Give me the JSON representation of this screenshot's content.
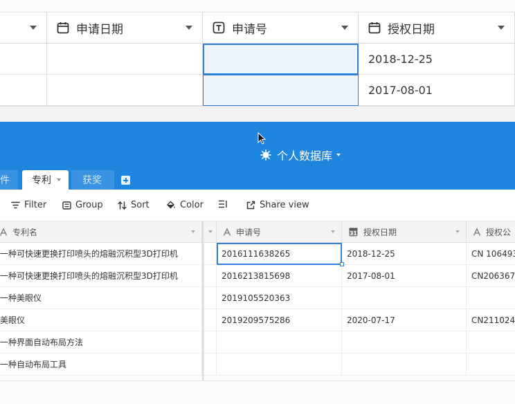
{
  "zoom_table": {
    "headers": [
      {
        "label": "",
        "icon": "none"
      },
      {
        "label": "申请日期",
        "icon": "calendar-icon"
      },
      {
        "label": "申请号",
        "icon": "text-field-icon"
      },
      {
        "label": "授权日期",
        "icon": "calendar-icon"
      }
    ],
    "rows": [
      [
        "",
        "",
        "",
        "2018-12-25"
      ],
      [
        "",
        "",
        "",
        "2017-08-01"
      ]
    ]
  },
  "app": {
    "db_title": "个人数据库",
    "tabs": [
      {
        "label": "件",
        "active": false
      },
      {
        "label": "专利",
        "active": true
      },
      {
        "label": "获奖",
        "active": false
      }
    ]
  },
  "toolbar": {
    "filter": "Filter",
    "group": "Group",
    "sort": "Sort",
    "color": "Color",
    "share_view": "Share view"
  },
  "grid": {
    "columns": [
      {
        "label": "专利名",
        "icon": "text-type-icon"
      },
      {
        "label": "申请号",
        "icon": "text-type-icon"
      },
      {
        "label": "授权日期",
        "icon": "date-31-icon"
      },
      {
        "label": "授权公",
        "icon": "text-type-icon"
      }
    ],
    "rows": [
      [
        "一种可快速更换打印喷头的熔融沉积型3D打印机",
        "2016111638265",
        "2018-12-25",
        "CN 106493"
      ],
      [
        "一种可快速更换打印喷头的熔融沉积型3D打印机",
        "2016213815698",
        "2017-08-01",
        "CN206367"
      ],
      [
        "一种美眼仪",
        "2019105520363",
        "",
        ""
      ],
      [
        "美眼仪",
        "2019209575286",
        "2020-07-17",
        "CN211024"
      ],
      [
        "一种界面自动布局方法",
        "",
        "",
        ""
      ],
      [
        "一种自动布局工具",
        "",
        "",
        ""
      ]
    ]
  }
}
